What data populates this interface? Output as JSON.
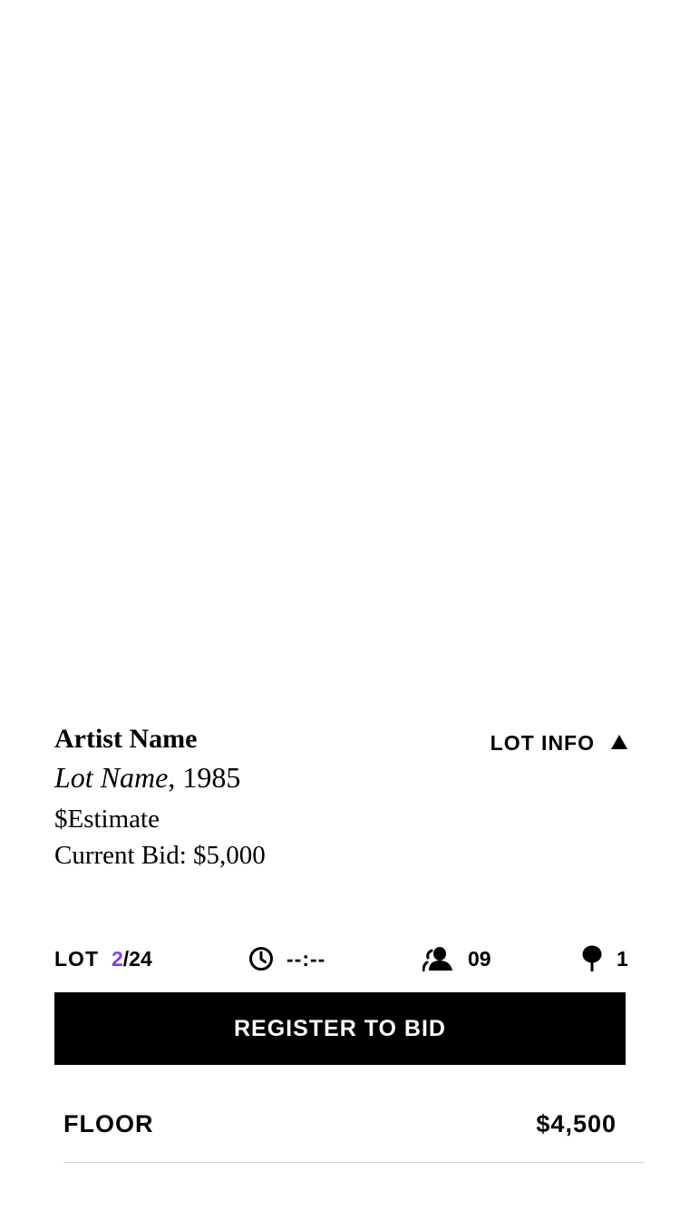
{
  "lot": {
    "artist_name": "Artist Name",
    "lot_name": "Lot Name",
    "year_suffix": ", 1985",
    "estimate": "$Estimate",
    "current_bid": "Current Bid: $5,000"
  },
  "lot_info_button": {
    "label": "LOT INFO",
    "icon": "triangle-up-icon"
  },
  "stats": {
    "lot_label": "LOT",
    "lot_current": "2",
    "lot_total": "/24",
    "timer_icon": "clock-icon",
    "timer_value": "--:--",
    "bidders_icon": "bidders-icon",
    "bidders_count": "09",
    "paddles_icon": "paddle-icon",
    "paddles_count": "1"
  },
  "register_button": {
    "label": "REGISTER TO BID"
  },
  "bid_history": [
    {
      "source": "FLOOR",
      "amount": "$4,500"
    }
  ],
  "colors": {
    "accent": "#7b3ff2",
    "button_background": "#000000",
    "button_text": "#ffffff",
    "divider": "#cccccc"
  }
}
